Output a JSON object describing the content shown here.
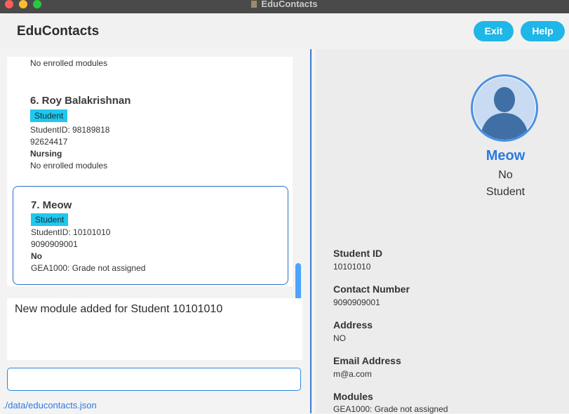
{
  "window": {
    "title": "EduContacts"
  },
  "header": {
    "app_name": "EduContacts",
    "exit_label": "Exit",
    "help_label": "Help"
  },
  "list": {
    "partial_top": {
      "modules": "No enrolled modules"
    },
    "cards": [
      {
        "name": "6. Roy Balakrishnan",
        "tag": "Student",
        "student_id": "StudentID: 98189818",
        "phone": "92624417",
        "address": "Nursing",
        "modules": "No enrolled modules"
      },
      {
        "name": "7. Meow",
        "tag": "Student",
        "student_id": "StudentID: 10101010",
        "phone": "9090909001",
        "address": "No",
        "modules": "GEA1000: Grade not assigned"
      }
    ]
  },
  "result": {
    "message": "New module added for Student 10101010"
  },
  "command": {
    "value": ""
  },
  "status": {
    "path": "./data/educontacts.json"
  },
  "details": {
    "name": "Meow",
    "address_line": "No",
    "role": "Student",
    "fields": [
      {
        "label": "Student ID",
        "value": "10101010"
      },
      {
        "label": "Contact Number",
        "value": "9090909001"
      },
      {
        "label": "Address",
        "value": "NO"
      },
      {
        "label": "Email Address",
        "value": "m@a.com"
      },
      {
        "label": "Modules",
        "value": "GEA1000: Grade not assigned"
      }
    ]
  }
}
